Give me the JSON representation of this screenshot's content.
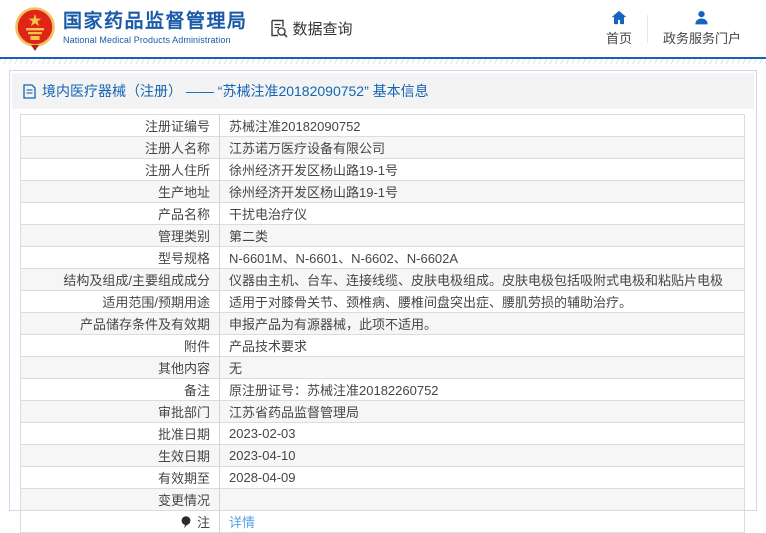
{
  "header": {
    "logo_title": "国家药品监督管理局",
    "logo_subtitle": "National Medical Products Administration",
    "data_query_label": "数据查询",
    "home_label": "首页",
    "portal_label": "政务服务门户"
  },
  "page_title": "境内医疗器械（注册） —— “苏械注准20182090752” 基本信息",
  "table": {
    "rows": [
      {
        "label": "注册证编号",
        "value": "苏械注准20182090752"
      },
      {
        "label": "注册人名称",
        "value": "江苏诺万医疗设备有限公司"
      },
      {
        "label": "注册人住所",
        "value": "徐州经济开发区杨山路19-1号"
      },
      {
        "label": "生产地址",
        "value": "徐州经济开发区杨山路19-1号"
      },
      {
        "label": "产品名称",
        "value": "干扰电治疗仪"
      },
      {
        "label": "管理类别",
        "value": "第二类"
      },
      {
        "label": "型号规格",
        "value": "N-6601M、N-6601、N-6602、N-6602A"
      },
      {
        "label": "结构及组成/主要组成成分",
        "value": "仪器由主机、台车、连接线缆、皮肤电极组成。皮肤电极包括吸附式电极和粘贴片电极"
      },
      {
        "label": "适用范围/预期用途",
        "value": "适用于对膝骨关节、颈椎病、腰椎间盘突出症、腰肌劳损的辅助治疗。"
      },
      {
        "label": "产品储存条件及有效期",
        "value": "申报产品为有源器械，此项不适用。"
      },
      {
        "label": "附件",
        "value": "产品技术要求"
      },
      {
        "label": "其他内容",
        "value": "无"
      },
      {
        "label": "备注",
        "value": "原注册证号：苏械注准20182260752"
      },
      {
        "label": "审批部门",
        "value": "江苏省药品监督管理局"
      },
      {
        "label": "批准日期",
        "value": "2023-02-03"
      },
      {
        "label": "生效日期",
        "value": "2023-04-10"
      },
      {
        "label": "有效期至",
        "value": "2028-04-09"
      },
      {
        "label": "变更情况",
        "value": ""
      },
      {
        "label": "注",
        "value": "详情",
        "link": true,
        "icon": "note-balloon"
      }
    ]
  },
  "colors": {
    "brand_blue": "#1a5aa8",
    "header_line_blue": "#1363b8",
    "title_blue": "#1464b4",
    "link_blue": "#55a1e8",
    "container_border": "#c9d9ef",
    "row_alt_bg": "#f6f6f6",
    "emblem_red": "#de2517",
    "emblem_gold": "#f2c25e"
  }
}
